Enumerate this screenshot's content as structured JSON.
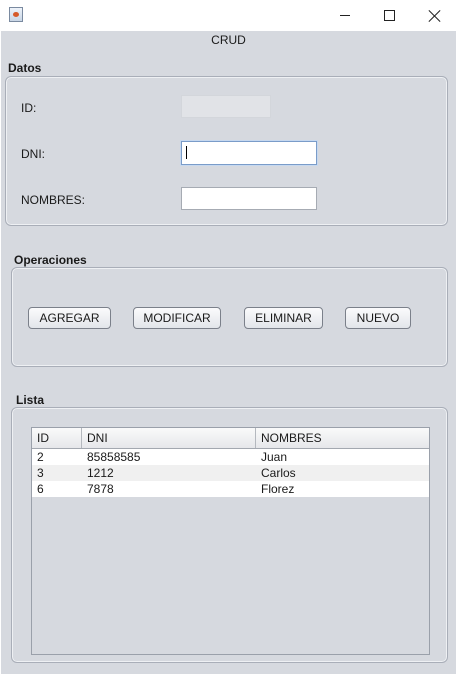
{
  "window": {
    "minimize_icon": "minimize-icon",
    "maximize_icon": "maximize-icon",
    "close_icon": "close-icon"
  },
  "form": {
    "title": "CRUD",
    "datos": {
      "title": "Datos",
      "id_label": "ID:",
      "id_value": "",
      "dni_label": "DNI:",
      "dni_value": "",
      "nombres_label": "NOMBRES:",
      "nombres_value": ""
    },
    "operaciones": {
      "title": "Operaciones",
      "buttons": [
        "AGREGAR",
        "MODIFICAR",
        "ELIMINAR",
        "NUEVO"
      ]
    },
    "lista": {
      "title": "Lista",
      "columns": [
        "ID",
        "DNI",
        "NOMBRES"
      ],
      "rows": [
        [
          "2",
          "85858585",
          "Juan"
        ],
        [
          "3",
          "1212",
          "Carlos"
        ],
        [
          "6",
          "7878",
          "Florez"
        ]
      ]
    }
  }
}
